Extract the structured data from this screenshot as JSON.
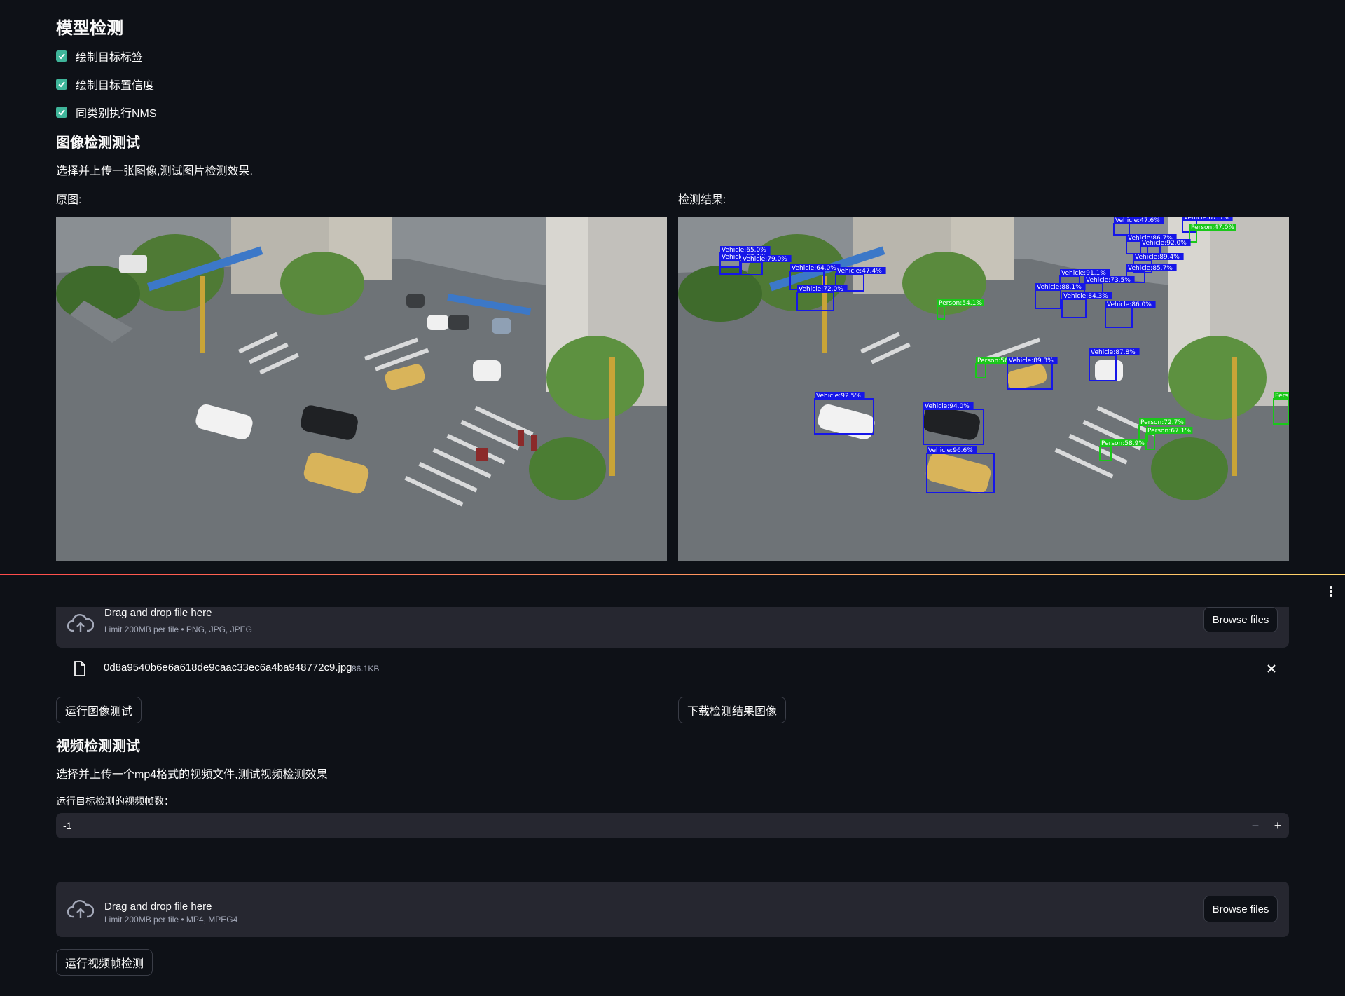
{
  "model_section": {
    "title": "模型检测",
    "options": [
      {
        "label": "绘制目标标签",
        "checked": true
      },
      {
        "label": "绘制目标置信度",
        "checked": true
      },
      {
        "label": "同类别执行NMS",
        "checked": true
      }
    ]
  },
  "image_section": {
    "title": "图像检测测试",
    "description": "选择并上传一张图像,测试图片检测效果.",
    "original_label": "原图:",
    "result_label": "检测结果:",
    "uploader": {
      "title": "Drag and drop file here",
      "limit": "Limit 200MB per file • PNG, JPG, JPEG",
      "browse_label": "Browse files"
    },
    "file": {
      "name": "0d8a9540b6e6a618de9caac33ec6a4ba948772c9.jpg",
      "size": "86.1KB"
    },
    "run_button": "运行图像测试",
    "download_button": "下载检测结果图像"
  },
  "detections": [
    {
      "label": "Vehicle:65.0%"
    },
    {
      "label": "Vehicle:62.1%"
    },
    {
      "label": "Vehicle:79.0%"
    },
    {
      "label": "Vehicle:64.0%"
    },
    {
      "label": "Vehicle:47.4%"
    },
    {
      "label": "Vehicle:72.0%"
    },
    {
      "label": "Person:54.1%"
    },
    {
      "label": "Vehicle:47.6%"
    },
    {
      "label": "Vehicle:67.5%"
    },
    {
      "label": "Vehicle:86.7%"
    },
    {
      "label": "Person:47.0%"
    },
    {
      "label": "Vehicle:92.0%"
    },
    {
      "label": "Vehicle:89.4%"
    },
    {
      "label": "Vehicle:85.7%"
    },
    {
      "label": "Vehicle:91.1%"
    },
    {
      "label": "Vehicle:73.5%"
    },
    {
      "label": "Vehicle:88.1%"
    },
    {
      "label": "Vehicle:84.3%"
    },
    {
      "label": "Vehicle:86.0%"
    },
    {
      "label": "Person:56.4%"
    },
    {
      "label": "Vehicle:89.3%"
    },
    {
      "label": "Vehicle:87.8%"
    },
    {
      "label": "Vehicle:92.5%"
    },
    {
      "label": "Vehicle:94.0%"
    },
    {
      "label": "Vehicle:96.6%"
    },
    {
      "label": "Person:72.7%"
    },
    {
      "label": "Person:67.1%"
    },
    {
      "label": "Person:58.9%"
    },
    {
      "label": "Pers"
    }
  ],
  "video_section": {
    "title": "视频检测测试",
    "description": "选择并上传一个mp4格式的视频文件,测试视频检测效果",
    "frames_label": "运行目标检测的视频帧数：",
    "frames_value": "-1",
    "uploader": {
      "title": "Drag and drop file here",
      "limit": "Limit 200MB per file • MP4, MPEG4",
      "browse_label": "Browse files"
    },
    "run_button": "运行视频帧检测"
  },
  "icons": {
    "checkbox": "check-icon",
    "upload": "cloud-upload-icon",
    "file": "file-icon",
    "remove": "close-icon",
    "menu": "more-vertical-icon",
    "minus": "minus-icon",
    "plus": "plus-icon"
  },
  "colors": {
    "background": "#0e1117",
    "widget": "#262730",
    "checkbox": "#3fb59a",
    "detection_vehicle": "#1616e8",
    "detection_person": "#1ac81a"
  }
}
